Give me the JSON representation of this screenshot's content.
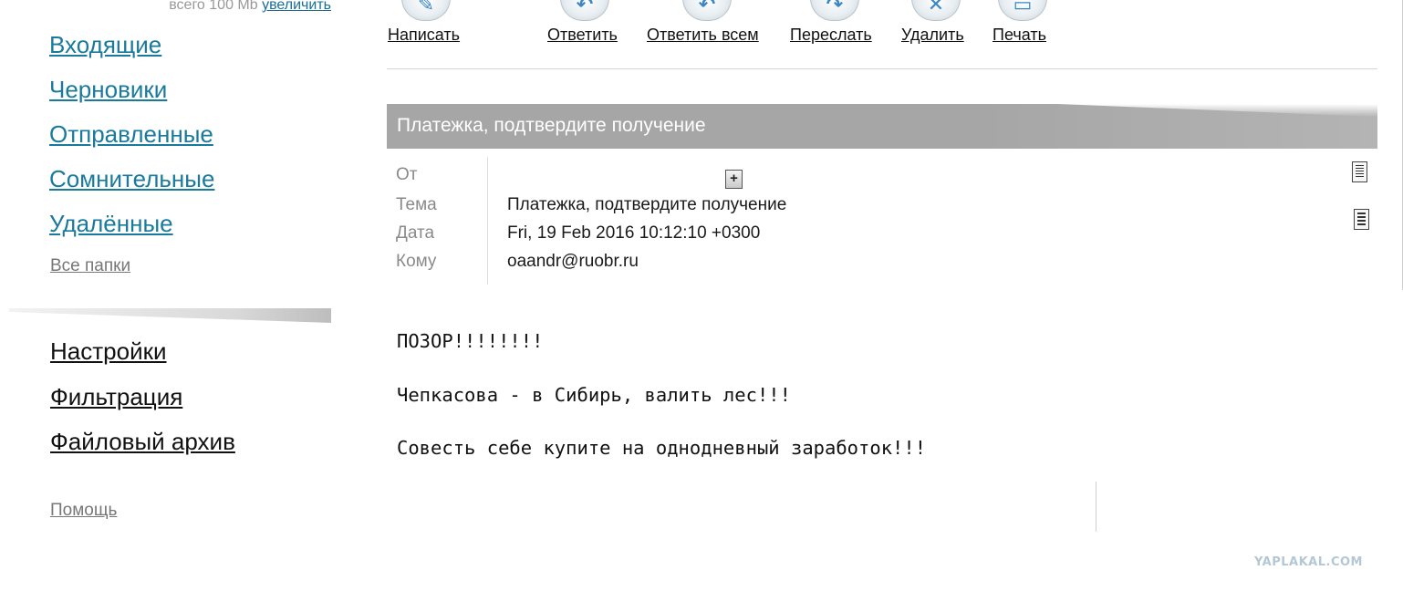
{
  "sidebar": {
    "quota_text": "всего 100 Mb",
    "quota_link": "увеличить",
    "folders": [
      {
        "label": "Входящие"
      },
      {
        "label": "Черновики"
      },
      {
        "label": "Отправленные"
      },
      {
        "label": "Сомнительные"
      },
      {
        "label": "Удалённые"
      }
    ],
    "all_folders": "Все папки",
    "settings": [
      {
        "label": "Настройки"
      },
      {
        "label": "Фильтрация"
      },
      {
        "label": "Файловый архив"
      }
    ],
    "help": "Помощь"
  },
  "toolbar": {
    "buttons": [
      {
        "label": "Написать",
        "icon": "compose-icon"
      },
      {
        "label": "Ответить",
        "icon": "reply-icon"
      },
      {
        "label": "Ответить всем",
        "icon": "reply-all-icon"
      },
      {
        "label": "Переслать",
        "icon": "forward-icon"
      },
      {
        "label": "Удалить",
        "icon": "delete-icon"
      },
      {
        "label": "Печать",
        "icon": "print-icon"
      }
    ]
  },
  "message": {
    "subject_bar": "Платежка, подтвердите получение",
    "meta": {
      "from_label": "От",
      "from_value": "",
      "subject_label": "Тема",
      "subject_value": "Платежка, подтвердите получение",
      "date_label": "Дата",
      "date_value": "Fri, 19 Feb 2016 10:12:10 +0300",
      "to_label": "Кому",
      "to_value": "oaandr@ruobr.ru"
    },
    "body_lines": [
      "ПОЗОР!!!!!!!!",
      "Чепкасова - в Сибирь, валить лес!!!",
      "Совесть себе купите на однодневный заработок!!!"
    ]
  },
  "watermark": "YAPLAKAL.COM",
  "colors": {
    "link": "#1a7a9e",
    "subject_bar": "#a6a6a6"
  }
}
